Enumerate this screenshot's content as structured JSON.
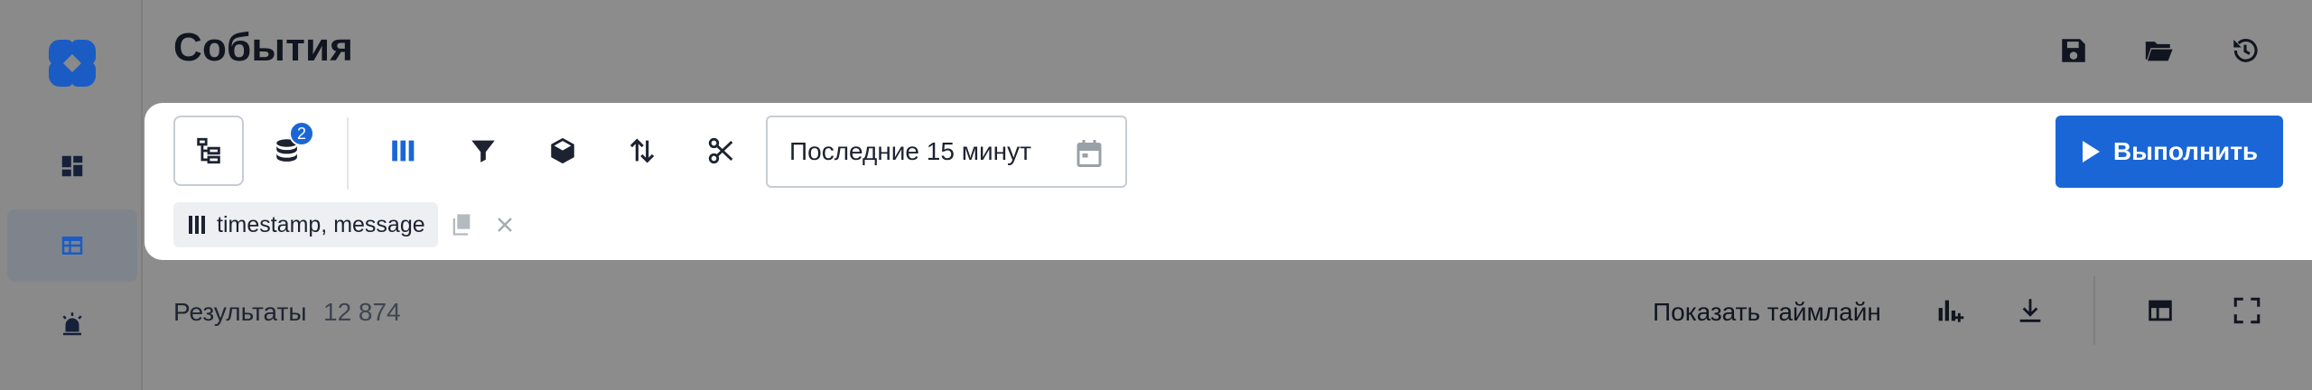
{
  "app": {
    "brand_color": "#1a66d6",
    "logo_icon": "clover-logo-icon"
  },
  "sidebar": {
    "items": [
      {
        "icon": "dashboard-icon",
        "active": false
      },
      {
        "icon": "table-icon",
        "active": true
      },
      {
        "icon": "alarm-icon",
        "active": false
      }
    ]
  },
  "header": {
    "title": "События",
    "actions": [
      "save-icon",
      "folder-open-icon",
      "history-icon"
    ]
  },
  "query": {
    "toolbar": [
      "tree-structure-icon",
      "database-icon",
      "columns-icon",
      "filter-icon",
      "cube-icon",
      "sort-icon",
      "scissors-icon"
    ],
    "sources_badge": "2",
    "time_range": "Последние 15 минут",
    "run_label": "Выполнить",
    "columns_chip": "timestamp, message"
  },
  "results": {
    "label": "Результаты",
    "count": "12 874",
    "timeline_label": "Показать таймлайн",
    "actions": [
      "chart-add-icon",
      "download-icon",
      "layout-icon",
      "fullscreen-icon"
    ]
  }
}
